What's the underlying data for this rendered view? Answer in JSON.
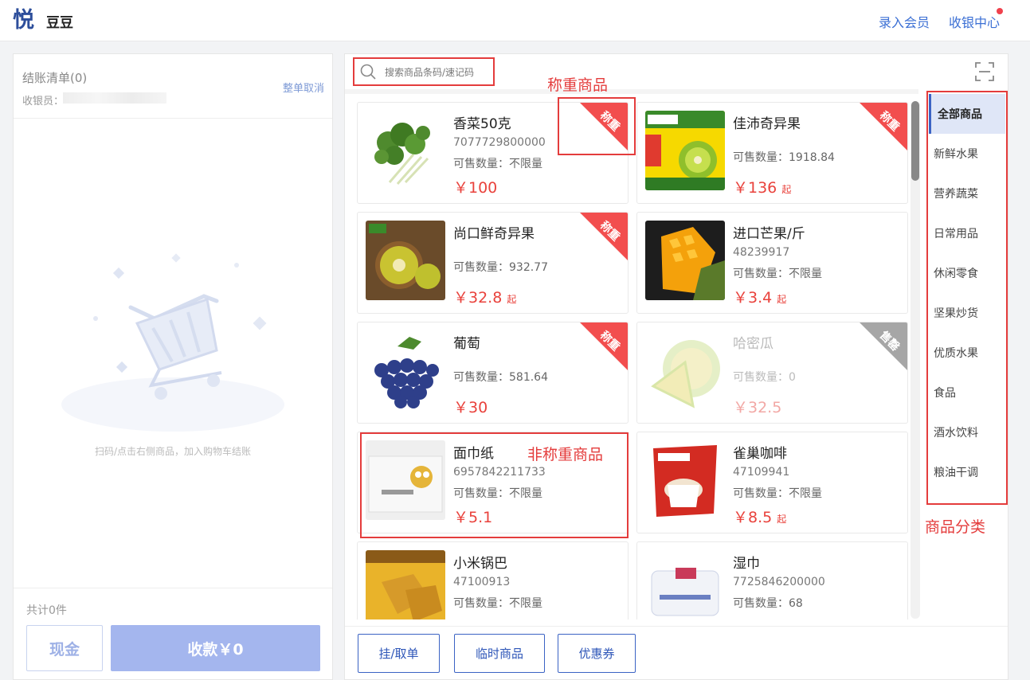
{
  "header": {
    "store_name": "豆豆",
    "logo_glyph": "悦",
    "register_member": "录入会员",
    "cashier_center": "收银中心"
  },
  "left": {
    "checkout_title": "结账清单(0)",
    "cancel_all": "整单取消",
    "cashier_label": "收银员：",
    "empty_hint": "扫码/点击右侧商品，加入购物车结账",
    "total": "共计0件",
    "cash_button": "现金",
    "pay_button": "收款￥0"
  },
  "search": {
    "placeholder": "搜索商品条码/速记码"
  },
  "products": [
    {
      "name": "香菜50克",
      "code": "7077729800000",
      "qty": "可售数量：不限量",
      "price": "￥100",
      "from": "",
      "tag": "称重"
    },
    {
      "name": "佳沛奇异果",
      "code": "",
      "qty": "可售数量：1918.84",
      "price": "￥136",
      "from": "起",
      "tag": "称重"
    },
    {
      "name": "尚口鲜奇异果",
      "code": "",
      "qty": "可售数量：932.77",
      "price": "￥32.8",
      "from": "起",
      "tag": "称重"
    },
    {
      "name": "进口芒果/斤",
      "code": "48239917",
      "qty": "可售数量：不限量",
      "price": "￥3.4",
      "from": "起",
      "tag": ""
    },
    {
      "name": "葡萄",
      "code": "",
      "qty": "可售数量：581.64",
      "price": "￥30",
      "from": "",
      "tag": "称重"
    },
    {
      "name": "哈密瓜",
      "code": "",
      "qty": "可售数量：0",
      "price": "￥32.5",
      "from": "",
      "tag": "售罄"
    },
    {
      "name": "面巾纸",
      "code": "6957842211733",
      "qty": "可售数量：不限量",
      "price": "￥5.1",
      "from": "",
      "tag": ""
    },
    {
      "name": "雀巢咖啡",
      "code": "47109941",
      "qty": "可售数量：不限量",
      "price": "￥8.5",
      "from": "起",
      "tag": ""
    },
    {
      "name": "小米锅巴",
      "code": "47100913",
      "qty": "可售数量：不限量",
      "price": "",
      "from": "",
      "tag": ""
    },
    {
      "name": "湿巾",
      "code": "7725846200000",
      "qty": "可售数量：68",
      "price": "",
      "from": "",
      "tag": ""
    }
  ],
  "toolbar": {
    "hang_order": "挂/取单",
    "temp_goods": "临时商品",
    "coupon": "优惠券"
  },
  "categories": [
    "全部商品",
    "新鲜水果",
    "营养蔬菜",
    "日常用品",
    "休闲零食",
    "坚果炒货",
    "优质水果",
    "食品",
    "酒水饮料",
    "粮油干调"
  ],
  "annotations": {
    "weighted": "称重商品",
    "non_weighted": "非称重商品",
    "category": "商品分类"
  },
  "colors": {
    "accent": "#3b63c4",
    "price": "#e9423c",
    "annotation": "#e43c3c"
  }
}
